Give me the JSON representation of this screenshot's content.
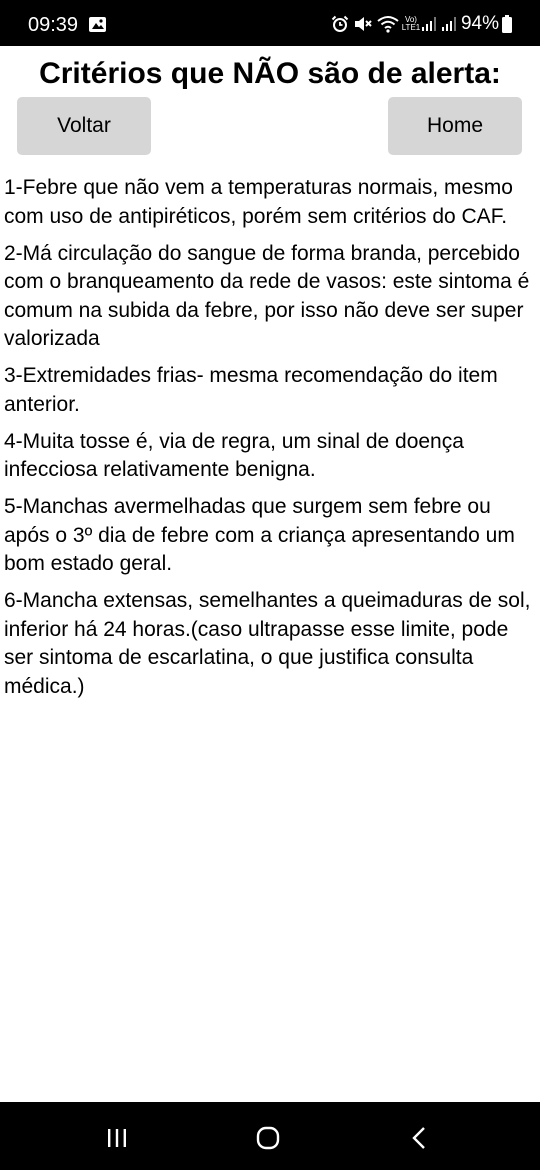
{
  "status_bar": {
    "time": "09:39",
    "battery": "94%",
    "network_label": "Vo) LTE1",
    "icons": [
      "gallery-icon",
      "alarm-icon",
      "mute-icon",
      "wifi-icon",
      "signal-icon",
      "signal-icon",
      "battery-icon"
    ]
  },
  "header": {
    "title": "Critérios que NÃO são de alerta:"
  },
  "buttons": {
    "back_label": "Voltar",
    "home_label": "Home"
  },
  "criteria": [
    "1-Febre que não vem a temperaturas normais, mesmo com uso de antipiréticos, porém sem critérios do CAF.",
    "2-Má circulação do sangue de forma branda, percebido com o branqueamento da rede de vasos: este sintoma é comum na subida da febre, por isso não deve ser super valorizada",
    "3-Extremidades frias- mesma recomendação do item anterior.",
    "4-Muita tosse é, via de regra, um sinal de doença infecciosa relativamente benigna.",
    "5-Manchas avermelhadas que surgem sem febre ou após o 3º dia de febre com a criança apresentando um bom estado geral.",
    "6-Mancha extensas, semelhantes a queimaduras de sol, inferior há 24 horas.(caso ultrapasse esse limite, pode ser sintoma de escarlatina, o que justifica consulta médica.)"
  ],
  "nav_bar": {
    "icons": [
      "recent-apps-icon",
      "home-circle-icon",
      "back-chevron-icon"
    ]
  }
}
